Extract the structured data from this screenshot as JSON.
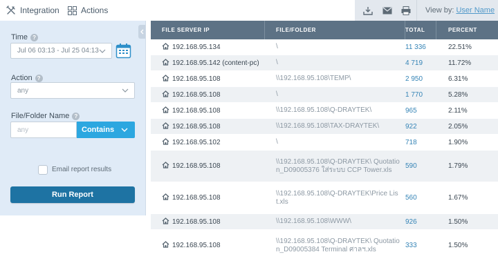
{
  "nav": {
    "integration_label": "Integration",
    "actions_label": "Actions"
  },
  "toolbar": {
    "view_by_label": "View by:",
    "view_by_value": "User Name"
  },
  "filters": {
    "time_label": "Time",
    "time_value": "Jul 06 03:13 - Jul 25 04:13",
    "action_label": "Action",
    "action_value": "any",
    "file_folder_label": "File/Folder Name",
    "file_folder_placeholder": "any",
    "match_mode": "Contains",
    "email_label": "Email report results",
    "email_checked": false,
    "run_label": "Run Report"
  },
  "table": {
    "columns": [
      "FILE SERVER IP",
      "FILE/FOLDER",
      "TOTAL",
      "PERCENT"
    ],
    "rows": [
      {
        "ip": "192.168.95.134",
        "folder": "\\",
        "total": "11 336",
        "percent": "22.51%"
      },
      {
        "ip": "192.168.95.142 (content-pc)",
        "folder": "\\",
        "total": "4 719",
        "percent": "11.72%"
      },
      {
        "ip": "192.168.95.108",
        "folder": "\\\\192.168.95.108\\TEMP\\",
        "total": "2 950",
        "percent": "6.31%"
      },
      {
        "ip": "192.168.95.108",
        "folder": "\\",
        "total": "1 770",
        "percent": "5.28%"
      },
      {
        "ip": "192.168.95.108",
        "folder": "\\\\192.168.95.108\\Q-DRAYTEK\\",
        "total": "965",
        "percent": "2.11%"
      },
      {
        "ip": "192.168.95.108",
        "folder": "\\\\192.168.95.108\\TAX-DRAYTEK\\",
        "total": "922",
        "percent": "2.05%"
      },
      {
        "ip": "192.168.95.102",
        "folder": "\\",
        "total": "718",
        "percent": "1.90%"
      },
      {
        "ip": "192.168.95.108",
        "folder": "\\\\192.168.95.108\\Q-DRAYTEK\\ Quotation_D09005376 ใส่ระบบ CCP Tower.xls",
        "total": "590",
        "percent": "1.79%"
      },
      {
        "ip": "192.168.95.108",
        "folder": "\\\\192.168.95.108\\Q-DRAYTEK\\Price List.xls",
        "total": "560",
        "percent": "1.67%"
      },
      {
        "ip": "192.168.95.108",
        "folder": "\\\\192.168.95.108\\WWW\\",
        "total": "926",
        "percent": "1.50%"
      },
      {
        "ip": "192.168.95.108",
        "folder": "\\\\192.168.95.108\\Q-DRAYTEK\\ Quotation_D09005384 Terminal ศาลฯ.xls",
        "total": "333",
        "percent": "1.50%"
      }
    ]
  }
}
